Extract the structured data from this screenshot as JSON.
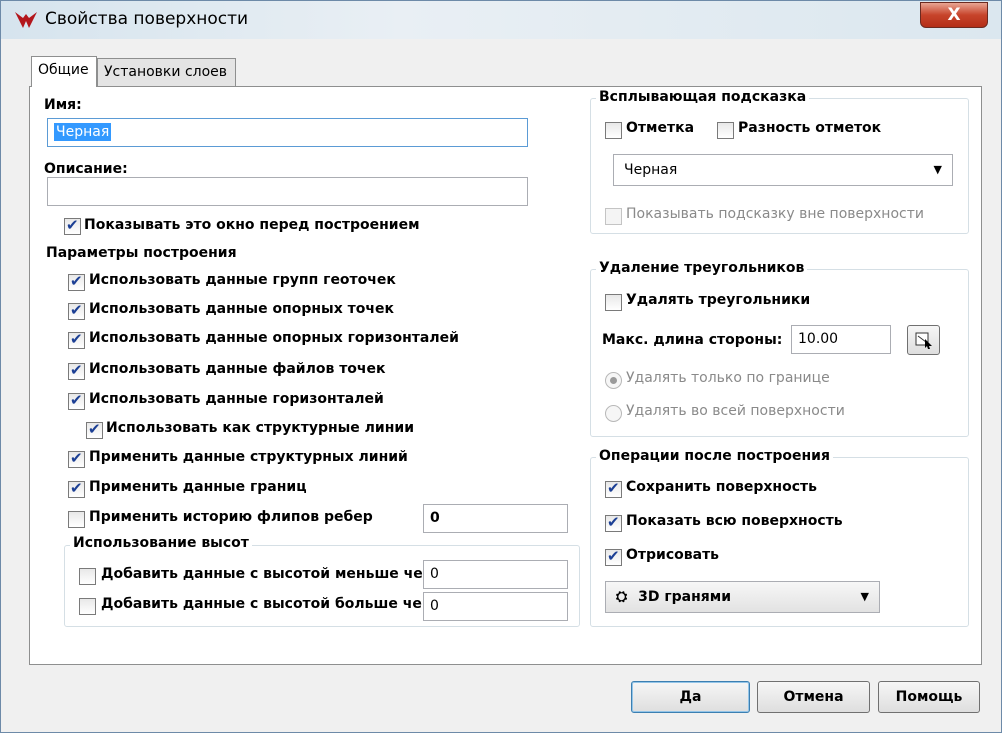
{
  "window": {
    "title": "Свойства поверхности",
    "close_label": "X"
  },
  "tabs": [
    {
      "label": "Общие"
    },
    {
      "label": "Установки слоев"
    }
  ],
  "general": {
    "name_label": "Имя:",
    "name_value": "Черная",
    "description_label": "Описание:",
    "description_value": "",
    "show_before_build": {
      "label": "Показывать это окно перед построением",
      "checked": true
    }
  },
  "build_params": {
    "title": "Параметры построения",
    "items": [
      {
        "label": "Использовать данные групп геоточек",
        "checked": true
      },
      {
        "label": "Использовать данные опорных точек",
        "checked": true
      },
      {
        "label": "Использовать данные опорных горизонталей",
        "checked": true
      },
      {
        "label": "Использовать данные файлов точек",
        "checked": true
      },
      {
        "label": "Использовать данные горизонталей",
        "checked": true
      },
      {
        "label": "Использовать как структурные линии",
        "checked": true
      },
      {
        "label": "Применить данные структурных линий",
        "checked": true
      },
      {
        "label": "Применить данные границ",
        "checked": true
      },
      {
        "label": "Применить историю флипов ребер",
        "checked": false
      }
    ],
    "flip_history_value": "0",
    "heights": {
      "title": "Использование высот",
      "less_label": "Добавить данные с высотой меньше чем:",
      "less_value": "0",
      "greater_label": "Добавить данные с высотой больше чем:",
      "greater_value": "0"
    }
  },
  "tooltip": {
    "title": "Всплывающая  подсказка",
    "elevation_label": "Отметка",
    "elevation_diff_label": "Разность отметок",
    "surface_select": "Черная",
    "outside_label": "Показывать подсказку вне поверхности"
  },
  "triangles": {
    "title": "Удаление треугольников",
    "delete_label": "Удалять треугольники",
    "max_side_label": "Макс. длина стороны:",
    "max_side_value": "10.00",
    "border_only_label": "Удалять только по границе",
    "whole_surface_label": "Удалять во всей поверхности"
  },
  "post_ops": {
    "title": "Операции после построения",
    "save_label": "Сохранить поверхность",
    "show_all_label": "Показать всю поверхность",
    "draw_label": "Отрисовать",
    "render_mode": "3D гранями"
  },
  "buttons": {
    "ok": "Да",
    "cancel": "Отмена",
    "help": "Помощь"
  }
}
